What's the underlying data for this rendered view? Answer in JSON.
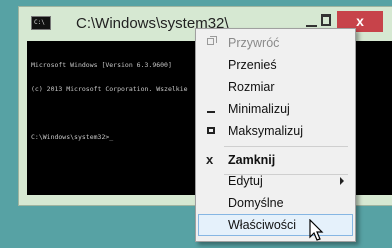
{
  "window": {
    "title": "C:\\Windows\\system32\\",
    "close_label": "x",
    "icon": "console-icon",
    "icon_text": "C:\\"
  },
  "console": {
    "lines": [
      "Microsoft Windows [Version 6.3.9600]",
      "(c) 2013 Microsoft Corporation. Wszelkie",
      "",
      "C:\\Windows\\system32>_"
    ]
  },
  "menu": {
    "items": [
      {
        "label": "Przywróć",
        "state": "disabled",
        "icon": "restore-icon"
      },
      {
        "label": "Przenieś",
        "state": "enabled"
      },
      {
        "label": "Rozmiar",
        "state": "enabled"
      },
      {
        "label": "Minimalizuj",
        "state": "enabled",
        "icon": "minimize-icon"
      },
      {
        "label": "Maksymalizuj",
        "state": "enabled",
        "icon": "maximize-icon"
      },
      {
        "label": "Zamknij",
        "state": "default",
        "icon": "close-icon",
        "glyph": "x"
      },
      {
        "label": "Edytuj",
        "state": "enabled",
        "icon": "submenu-arrow-icon"
      },
      {
        "label": "Domyślne",
        "state": "enabled"
      },
      {
        "label": "Właściwości",
        "state": "highlighted"
      }
    ]
  },
  "colors": {
    "desktop": "#57a2a4",
    "close_button": "#c7434a",
    "menu_highlight": "#e5f1fb"
  }
}
